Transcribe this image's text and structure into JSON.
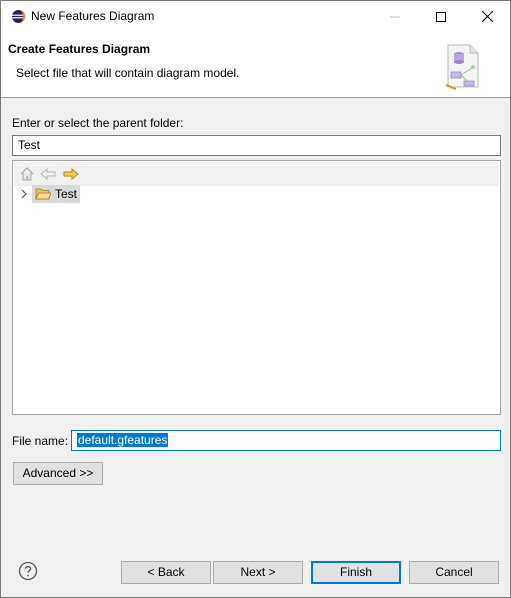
{
  "window": {
    "title": "New Features Diagram"
  },
  "banner": {
    "title": "Create Features Diagram",
    "description": "Select file that will contain diagram model."
  },
  "folder": {
    "label": "Enter or select the parent folder:",
    "value": "Test"
  },
  "tree": {
    "toolbar_icons": [
      "home-icon",
      "back-arrow-icon",
      "forward-arrow-icon"
    ],
    "items": [
      {
        "label": "Test",
        "icon": "open-folder-icon",
        "expanded": false,
        "selected": true
      }
    ]
  },
  "file": {
    "label": "File name:",
    "value": "default.gfeatures"
  },
  "buttons": {
    "advanced": "Advanced >>",
    "back": "< Back",
    "next": "Next >",
    "finish": "Finish",
    "cancel": "Cancel"
  },
  "colors": {
    "accent": "#0078d7",
    "background": "#f0f0f0",
    "selection": "#0078d7"
  }
}
